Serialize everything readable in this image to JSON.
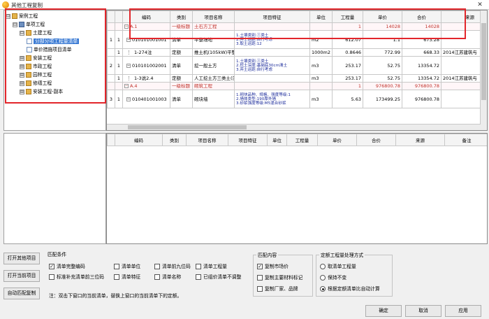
{
  "window": {
    "title": "其他工程复制",
    "close": "✕"
  },
  "tree": {
    "nodes": [
      {
        "label": "案例工程",
        "toggle": "⊟",
        "indent": 0
      },
      {
        "label": "单项工程",
        "toggle": "⊟",
        "indent": 1
      },
      {
        "label": "土建工程",
        "toggle": "⊟",
        "indent": 2
      },
      {
        "label": "分部分项工程量清单",
        "toggle": "",
        "indent": 3,
        "selected": true
      },
      {
        "label": "单价措施项目清单",
        "toggle": "",
        "indent": 3
      },
      {
        "label": "安装工程",
        "toggle": "⊞",
        "indent": 2
      },
      {
        "label": "市政工程",
        "toggle": "⊞",
        "indent": 2
      },
      {
        "label": "园林工程",
        "toggle": "⊞",
        "indent": 2
      },
      {
        "label": "修缮工程",
        "toggle": "⊞",
        "indent": 2
      },
      {
        "label": "安装工程-副本",
        "toggle": "⊞",
        "indent": 2
      }
    ]
  },
  "upper_grid": {
    "headers": [
      "",
      "",
      "编码",
      "类别",
      "项目名称",
      "项目特征",
      "单位",
      "工程量",
      "单价",
      "合价",
      "来源"
    ],
    "rows": [
      {
        "c0": "",
        "c1": "",
        "code": "A.1",
        "cat": "一级标题",
        "name": "土石方工程",
        "feat": "",
        "unit": "",
        "qty": "1",
        "price": "14028",
        "total": "14028",
        "src": "",
        "type": "title"
      },
      {
        "c0": "1",
        "c1": "1",
        "code": "010101001001",
        "cat": "清单",
        "name": "平整场地",
        "feat": "1.土壤类别:三类土\n2.弃土运距:自行考虑\n3.取土运距:12",
        "unit": "m2",
        "qty": "612.07",
        "price": "1.1",
        "total": "673.28",
        "src": "",
        "type": "item"
      },
      {
        "c0": "",
        "c1": "1",
        "code": "1-274注",
        "cat": "定额",
        "name": "推土机(105kW)平整场",
        "feat": "",
        "unit": "1000m2",
        "qty": "0.8646",
        "price": "772.99",
        "total": "668.33",
        "src": "2014江苏建筑与",
        "type": "quota"
      },
      {
        "c0": "2",
        "c1": "1",
        "code": "010101002001",
        "cat": "清单",
        "name": "挖一般土方",
        "feat": "1.土壤类别:三类土\n2.挖土深度:基础底30cm清土\n3.弃土运距:自行考虑",
        "unit": "m3",
        "qty": "253.17",
        "price": "52.75",
        "total": "13354.72",
        "src": "",
        "type": "item"
      },
      {
        "c0": "",
        "c1": "1",
        "code": "1-3说2.4",
        "cat": "定额",
        "name": "人工挖土方三类土(深",
        "feat": "",
        "unit": "m3",
        "qty": "253.17",
        "price": "52.75",
        "total": "13354.72",
        "src": "2014江苏建筑与",
        "type": "quota"
      },
      {
        "c0": "",
        "c1": "",
        "code": "A.4",
        "cat": "一级标题",
        "name": "砌筑工程",
        "feat": "",
        "unit": "",
        "qty": "1",
        "price": "976800.78",
        "total": "976800.78",
        "src": "",
        "type": "title"
      },
      {
        "c0": "3",
        "c1": "1",
        "code": "010401001003",
        "cat": "清单",
        "name": "砌块墙",
        "feat": "1.砌块品种、规格、强度等级:1\n2.墙体类型:190厚外墙\n3.砂浆强度等级:M5混合砂浆",
        "unit": "m3",
        "qty": "5.63",
        "price": "173499.25",
        "total": "976800.78",
        "src": "",
        "type": "item"
      }
    ]
  },
  "lower_grid": {
    "headers": [
      "",
      "编码",
      "类别",
      "项目名称",
      "项目特征",
      "单位",
      "工程量",
      "单价",
      "合价",
      "来源",
      "备注"
    ]
  },
  "side_buttons": [
    "打开其他项目",
    "打开当前项目",
    "自动匹配复制"
  ],
  "match_conditions": {
    "label": "匹配条件",
    "options": [
      {
        "label": "清单完整编码",
        "checked": true
      },
      {
        "label": "清单单位",
        "checked": false
      },
      {
        "label": "清单前九位码",
        "checked": false
      },
      {
        "label": "清单工程量",
        "checked": false
      },
      {
        "label": "标准补充清单前三位码",
        "checked": false
      },
      {
        "label": "清单特征",
        "checked": false
      },
      {
        "label": "清单名称",
        "checked": false
      },
      {
        "label": "已组价清单不调整",
        "checked": false
      }
    ],
    "note": "注：双击下窗口的当前清单，替换上窗口的当前清单下的定额。"
  },
  "match_content": {
    "label": "匹配内容",
    "options": [
      {
        "label": "复制市场价",
        "checked": true
      },
      {
        "label": "复制主要材料标记",
        "checked": false
      },
      {
        "label": "复制厂家、品牌",
        "checked": false
      }
    ]
  },
  "quota_method": {
    "label": "定额工程量处理方式",
    "options": [
      {
        "label": "取清单工程量",
        "selected": false
      },
      {
        "label": "保持不变",
        "selected": false
      },
      {
        "label": "根据定额清单比自动计算",
        "selected": true
      }
    ]
  },
  "dialog_buttons": {
    "ok": "确定",
    "cancel": "取消",
    "apply": "应用"
  },
  "colors": {
    "highlight": "#e2262b",
    "selected": "#3b7bd4",
    "title_text": "#c0322b"
  }
}
